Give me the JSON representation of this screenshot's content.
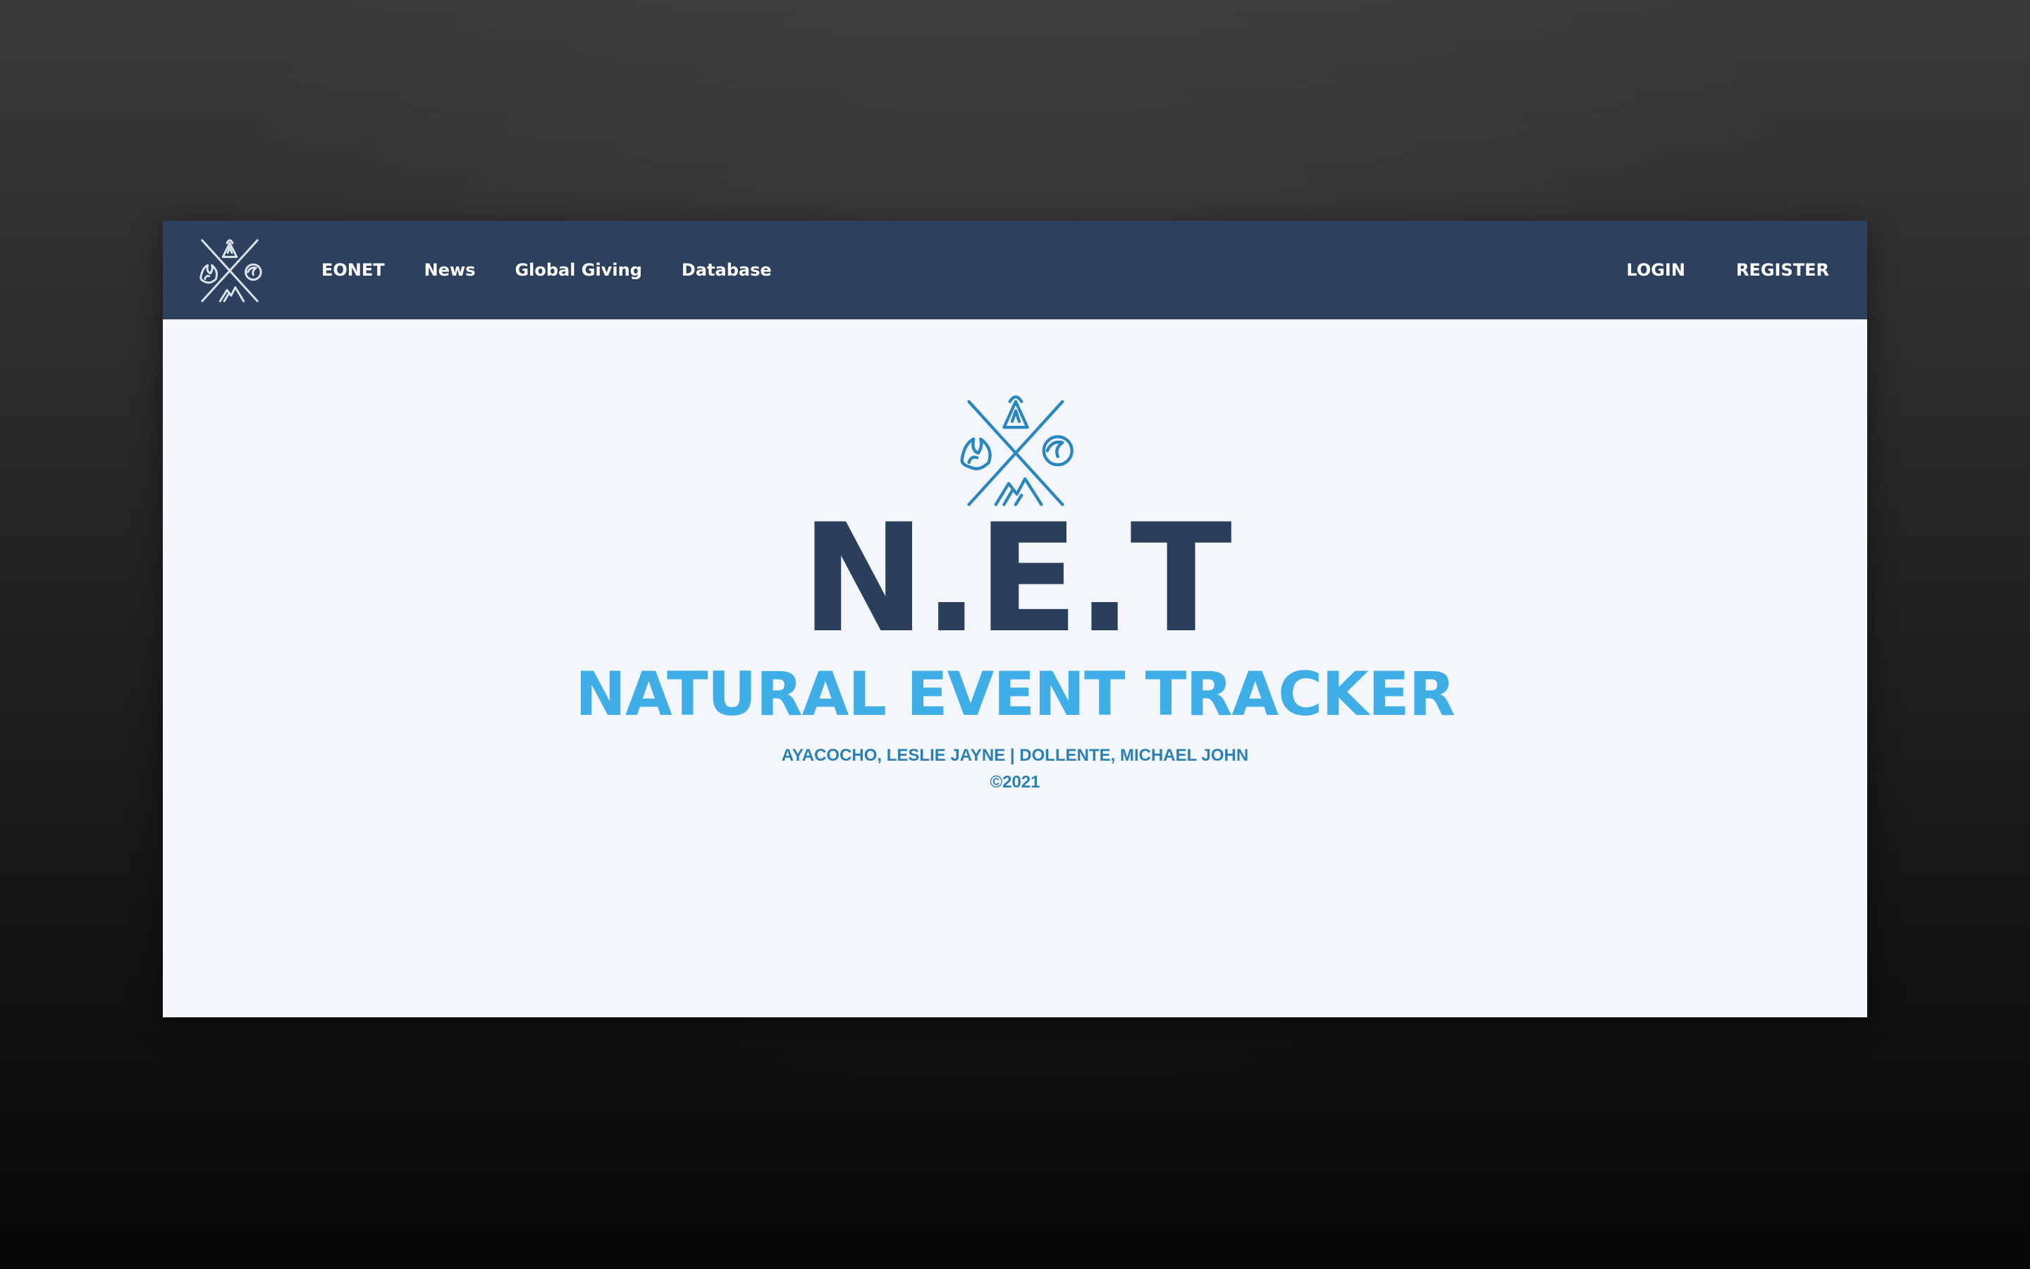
{
  "navbar": {
    "logo_icon": "net-emblem-icon",
    "links": [
      {
        "label": "EONET"
      },
      {
        "label": "News"
      },
      {
        "label": "Global Giving"
      },
      {
        "label": "Database"
      }
    ],
    "login_label": "LOGIN",
    "register_label": "REGISTER"
  },
  "hero": {
    "logo_icon": "net-emblem-icon",
    "title": "N.E.T",
    "subtitle": "NATURAL EVENT TRACKER",
    "authors": "AYACOCHO, LESLIE JAYNE | DOLLENTE, MICHAEL JOHN",
    "copyright": "©2021"
  },
  "colors": {
    "navbar_bg": "#2d415e",
    "page_bg": "#f3f7fb",
    "title": "#2b3f5d",
    "subtitle": "#3fade6",
    "authors": "#2a7fb5",
    "emblem": "#2a86bf"
  }
}
